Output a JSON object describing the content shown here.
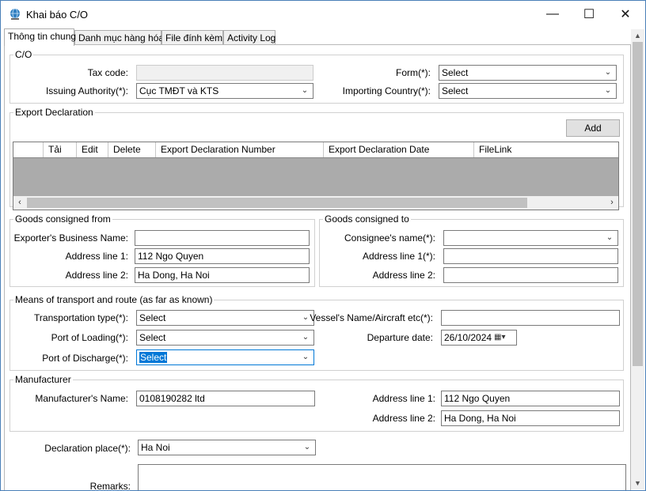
{
  "window": {
    "title": "Khai báo C/O",
    "minimize": "—",
    "maximize": "☐",
    "close": "✕"
  },
  "tabs": [
    {
      "label": "Thông tin chung",
      "active": true
    },
    {
      "label": "Danh mục hàng hóa",
      "active": false
    },
    {
      "label": "File đính kèm",
      "active": false
    },
    {
      "label": "Activity Log",
      "active": false
    }
  ],
  "co": {
    "legend": "C/O",
    "tax_code_label": "Tax code:",
    "tax_code_value": "",
    "issuing_label": "Issuing Authority(*):",
    "issuing_value": "Cục TMĐT và KTS",
    "form_label": "Form(*):",
    "form_value": "Select",
    "importing_label": "Importing Country(*):",
    "importing_value": "Select"
  },
  "export_declaration": {
    "legend": "Export Declaration",
    "add_label": "Add",
    "columns": [
      "Tải",
      "Edit",
      "Delete",
      "Export Declaration Number",
      "Export Declaration Date",
      "FileLink"
    ]
  },
  "goods_from": {
    "legend": "Goods consigned from",
    "business_label": "Exporter's Business Name:",
    "business_value": "",
    "addr1_label": "Address line 1:",
    "addr1_value": "112 Ngo Quyen",
    "addr2_label": "Address line 2:",
    "addr2_value": "Ha Dong, Ha Noi"
  },
  "goods_to": {
    "legend": "Goods consigned to",
    "consignee_label": "Consignee's name(*):",
    "consignee_value": "",
    "addr1_label": "Address line 1(*):",
    "addr1_value": "",
    "addr2_label": "Address line 2:",
    "addr2_value": ""
  },
  "transport": {
    "legend": "Means of transport and route (as far as known)",
    "type_label": "Transportation type(*):",
    "type_value": "Select",
    "loading_label": "Port of Loading(*):",
    "loading_value": "Select",
    "discharge_label": "Port of Discharge(*):",
    "discharge_value": "Select",
    "vessel_label": "Vessel's Name/Aircraft etc(*):",
    "vessel_value": "",
    "departure_label": "Departure date:",
    "departure_value": "26/10/2024"
  },
  "manufacturer": {
    "legend": "Manufacturer",
    "name_label": "Manufacturer's Name:",
    "name_value": "0108190282 ltd",
    "addr1_label": "Address line 1:",
    "addr1_value": "112 Ngo Quyen",
    "addr2_label": "Address line 2:",
    "addr2_value": "Ha Dong, Ha Noi"
  },
  "declaration_place_label": "Declaration place(*):",
  "declaration_place_value": "Ha Noi",
  "remarks_label": "Remarks:",
  "remarks_value": ""
}
